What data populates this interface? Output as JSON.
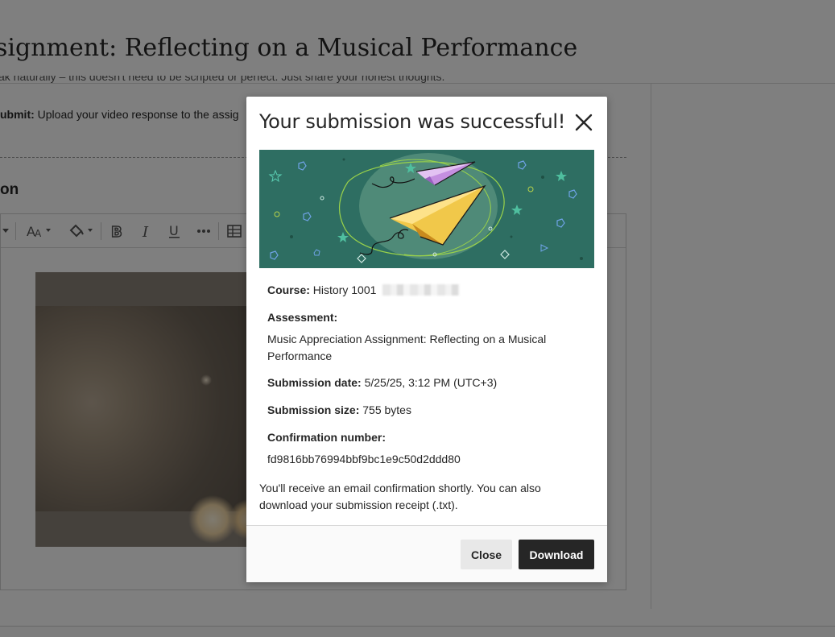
{
  "background": {
    "page_title": "Music Appreciation Assignment: Reflecting on a Musical Performance",
    "page_title_visible": "signment: Reflecting on a Musical Performance",
    "cut_line_text": "ak naturally – this doesn't need to be scripted or perfect. Just share your honest thoughts.",
    "submit_label": "ubmit:",
    "submit_text": " Upload your video response to the assig",
    "section_heading": "on"
  },
  "modal": {
    "title": "Your submission was successful!",
    "course_label": "Course:",
    "course_value": "History 1001",
    "assessment_label": "Assessment:",
    "assessment_value_line1": "Music Appreciation Assignment: Reflecting on a Musical",
    "assessment_value_line2": "Performance",
    "submission_date_label": "Submission date:",
    "submission_date_value": "5/25/25, 3:12 PM (UTC+3)",
    "submission_size_label": "Submission size:",
    "submission_size_value": "755 bytes",
    "confirmation_label": "Confirmation number:",
    "confirmation_value": "fd9816bb76994bbf9bc1e9c50d2ddd80",
    "note_line1": "You'll receive an email confirmation shortly. You can also",
    "note_line2": "download your submission receipt (.txt).",
    "close_button": "Close",
    "download_button": "Download"
  },
  "colors": {
    "banner_bg": "#2e6e62",
    "primary_button": "#262626",
    "secondary_button": "#e8e8e8"
  },
  "icons": [
    "close-icon",
    "font-size-icon",
    "highlight-icon",
    "bold-icon",
    "italic-icon",
    "underline-icon",
    "more-icon",
    "table-icon",
    "paper-plane-illustration"
  ]
}
